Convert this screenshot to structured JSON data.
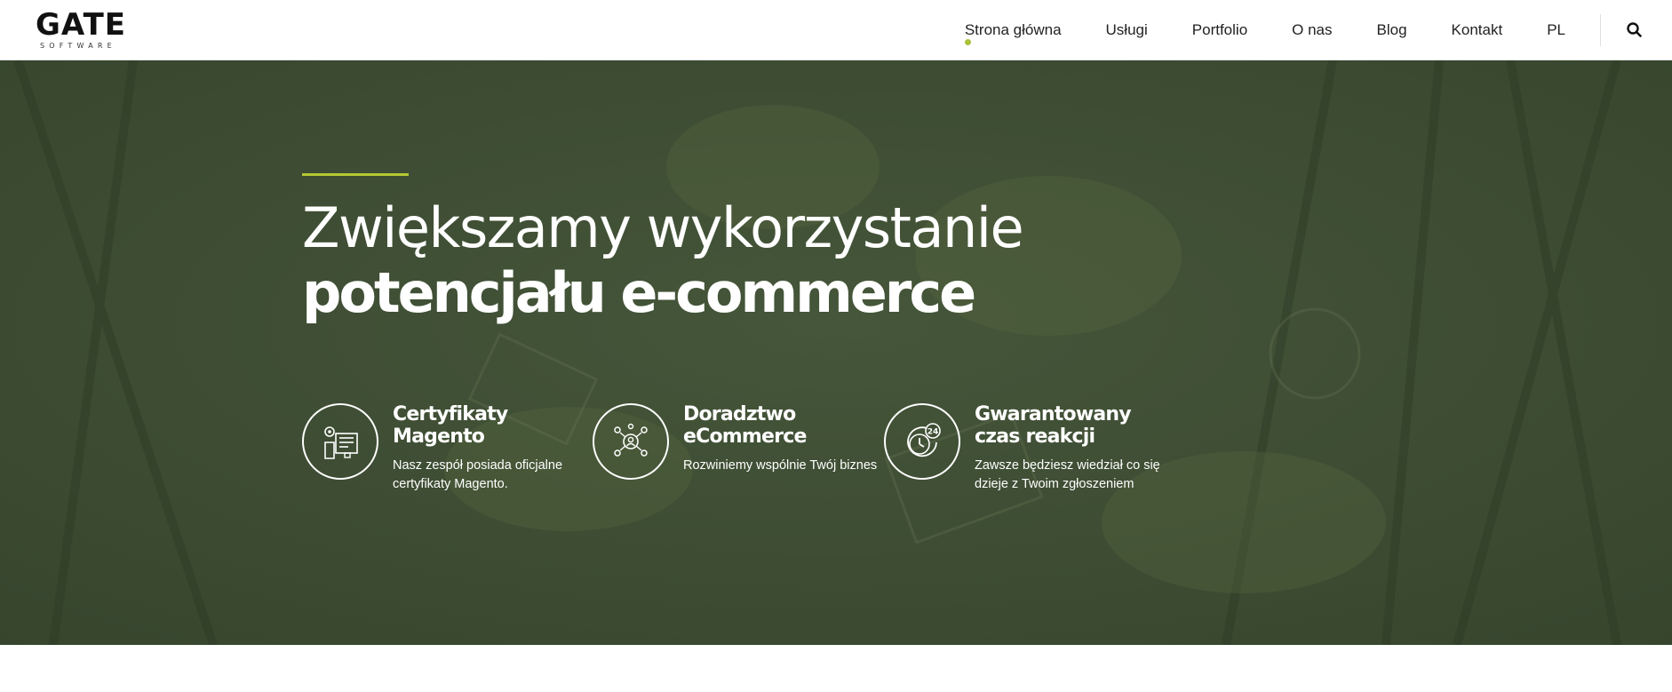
{
  "brand": {
    "logo_text": "GATE",
    "logo_subtext": "SOFTWARE"
  },
  "nav": {
    "items": [
      {
        "label": "Strona główna",
        "active": true
      },
      {
        "label": "Usługi"
      },
      {
        "label": "Portfolio"
      },
      {
        "label": "O nas"
      },
      {
        "label": "Blog"
      },
      {
        "label": "Kontakt"
      },
      {
        "label": "PL"
      }
    ],
    "search_icon": "search-icon"
  },
  "hero": {
    "title_line1": "Zwiększamy wykorzystanie",
    "title_line2": "potencjału e-commerce",
    "features": [
      {
        "icon": "certificate-icon",
        "title_line1": "Certyfikaty",
        "title_line2": "Magento",
        "desc_line1": "Nasz zespół posiada oficjalne",
        "desc_line2": "certyfikaty Magento."
      },
      {
        "icon": "consulting-team-icon",
        "title_line1": "Doradztwo",
        "title_line2": "eCommerce",
        "desc_line1": "Rozwiniemy wspólnie Twój biznes",
        "desc_line2": ""
      },
      {
        "icon": "clock-24h-icon",
        "title_line1": "Gwarantowany",
        "title_line2": "czas reakcji",
        "desc_line1": "Zawsze będziesz wiedział co się",
        "desc_line2": "dzieje z Twoim zgłoszeniem"
      }
    ]
  },
  "colors": {
    "accent": "#b5c832",
    "hero_overlay": "#3f4f34",
    "nav_dot": "#a8c23a"
  }
}
